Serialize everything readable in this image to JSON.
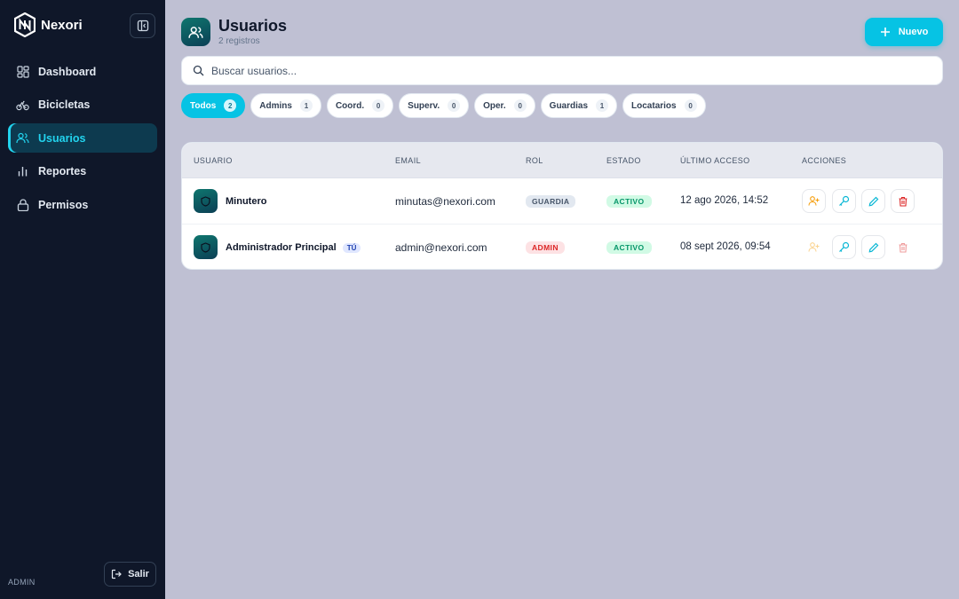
{
  "sidebar": {
    "brand": "Nexori",
    "items": [
      {
        "label": "Dashboard",
        "icon": "dashboard-icon"
      },
      {
        "label": "Bicicletas",
        "icon": "bicycle-icon"
      },
      {
        "label": "Usuarios",
        "icon": "users-icon",
        "active": true
      },
      {
        "label": "Reportes",
        "icon": "bar-chart-icon"
      },
      {
        "label": "Permisos",
        "icon": "lock-icon"
      }
    ],
    "role": "ADMIN",
    "logout_label": "Salir"
  },
  "header": {
    "title": "Usuarios",
    "subtitle": "2 registros",
    "new_label": "Nuevo"
  },
  "search": {
    "placeholder": "Buscar usuarios...",
    "value": ""
  },
  "filters": [
    {
      "label": "Todos",
      "count": "2",
      "active": true
    },
    {
      "label": "Admins",
      "count": "1"
    },
    {
      "label": "Coord.",
      "count": "0"
    },
    {
      "label": "Superv.",
      "count": "0"
    },
    {
      "label": "Oper.",
      "count": "0"
    },
    {
      "label": "Guardias",
      "count": "1"
    },
    {
      "label": "Locatarios",
      "count": "0"
    }
  ],
  "table": {
    "columns": [
      "USUARIO",
      "EMAIL",
      "ROL",
      "ESTADO",
      "ÚLTIMO ACCESO",
      "ACCIONES"
    ],
    "rows": [
      {
        "name": "Minutero",
        "badge": "",
        "email": "minutas@nexori.com",
        "role": "GUARDIA",
        "status": "ACTIVO",
        "last_access": "12 ago 2026, 14:52"
      },
      {
        "name": "Administrador Principal",
        "badge": "TÚ",
        "email": "admin@nexori.com",
        "role": "ADMIN",
        "status": "ACTIVO",
        "last_access": "08 sept 2026, 09:54"
      }
    ]
  },
  "colors": {
    "accent": "#06c3e4",
    "sidebar_bg": "#0f1729",
    "page_bg": "#bfc0d3",
    "success": "#059669",
    "danger": "#dc2626",
    "warning": "#f59e0b"
  }
}
